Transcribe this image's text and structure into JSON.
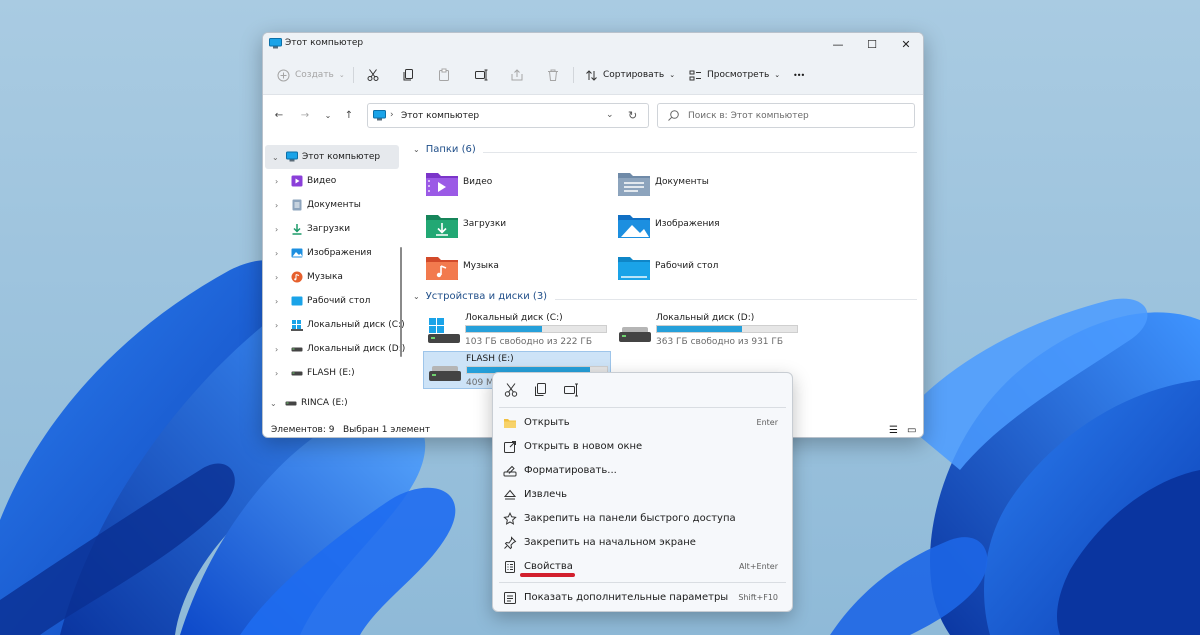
{
  "window": {
    "title": "Этот компьютер",
    "controls": {
      "minimize": "—",
      "maximize": "☐",
      "close": "✕"
    }
  },
  "toolbar": {
    "create_label": "Создать",
    "sort_label": "Сортировать",
    "view_label": "Просмотреть",
    "more_label": "•••"
  },
  "address": {
    "path_separator": "›",
    "path": "Этот компьютер",
    "search_placeholder": "Поиск в: Этот компьютер"
  },
  "sidebar": {
    "items": [
      {
        "label": "Этот компьютер",
        "icon": "pc-icon",
        "selected": true
      },
      {
        "label": "Видео",
        "icon": "video-icon"
      },
      {
        "label": "Документы",
        "icon": "documents-icon"
      },
      {
        "label": "Загрузки",
        "icon": "downloads-icon"
      },
      {
        "label": "Изображения",
        "icon": "pictures-icon"
      },
      {
        "label": "Музыка",
        "icon": "music-icon"
      },
      {
        "label": "Рабочий стол",
        "icon": "desktop-icon"
      },
      {
        "label": "Локальный диск (C:)",
        "icon": "drive-icon"
      },
      {
        "label": "Локальный диск (D:)",
        "icon": "drive-icon"
      },
      {
        "label": "FLASH (E:)",
        "icon": "usb-drive-icon"
      },
      {
        "label": "RINCA (E:)",
        "icon": "usb-drive-icon"
      }
    ]
  },
  "content": {
    "folders_header": "Папки (6)",
    "folders": [
      {
        "label": "Видео",
        "icon": "video-folder-icon"
      },
      {
        "label": "Документы",
        "icon": "documents-folder-icon"
      },
      {
        "label": "Загрузки",
        "icon": "downloads-folder-icon"
      },
      {
        "label": "Изображения",
        "icon": "pictures-folder-icon"
      },
      {
        "label": "Музыка",
        "icon": "music-folder-icon"
      },
      {
        "label": "Рабочий стол",
        "icon": "desktop-folder-icon"
      }
    ],
    "drives_header": "Устройства и диски (3)",
    "drives": [
      {
        "name": "Локальный диск (C:)",
        "free": "103 ГБ свободно из 222 ГБ",
        "used_fraction": 0.54,
        "icon": "windows-drive-icon"
      },
      {
        "name": "Локальный диск (D:)",
        "free": "363 ГБ свободно из 931 ГБ",
        "used_fraction": 0.61,
        "icon": "drive-icon"
      },
      {
        "name": "FLASH (E:)",
        "free": "409 МБ",
        "used_fraction": 0.88,
        "icon": "usb-drive-icon",
        "selected": true
      }
    ]
  },
  "status": {
    "items_count": "Элементов: 9",
    "selected": "Выбран 1 элемент"
  },
  "context_menu": {
    "quick_actions": [
      "cut-icon",
      "copy-icon",
      "rename-icon"
    ],
    "items": [
      {
        "label": "Открыть",
        "shortcut": "Enter",
        "icon": "folder-open-icon"
      },
      {
        "label": "Открыть в новом окне",
        "shortcut": "",
        "icon": "new-window-icon"
      },
      {
        "label": "Форматировать...",
        "shortcut": "",
        "icon": "format-icon"
      },
      {
        "label": "Извлечь",
        "shortcut": "",
        "icon": "eject-icon"
      },
      {
        "label": "Закрепить на панели быстрого доступа",
        "shortcut": "",
        "icon": "star-icon"
      },
      {
        "label": "Закрепить на начальном экране",
        "shortcut": "",
        "icon": "pin-icon"
      },
      {
        "label": "Свойства",
        "shortcut": "Alt+Enter",
        "icon": "properties-icon",
        "highlighted": true
      },
      {
        "label": "Показать дополнительные параметры",
        "shortcut": "Shift+F10",
        "icon": "more-options-icon"
      }
    ]
  },
  "colors": {
    "accent": "#26a0da",
    "highlight_underline": "#d21f2d",
    "wallpaper_bloom": "#1558d6"
  }
}
